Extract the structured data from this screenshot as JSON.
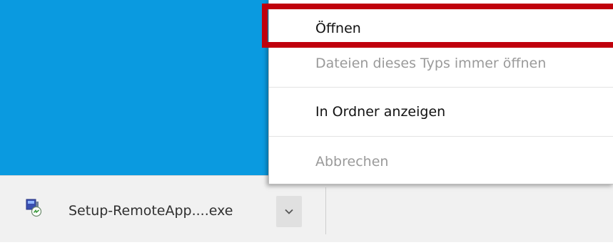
{
  "download_bar": {
    "file_name": "Setup-RemoteApp....exe",
    "file_icon": "installer-icon",
    "menu_button_icon": "chevron-down-icon"
  },
  "context_menu": {
    "items": [
      {
        "label": "Öffnen",
        "enabled": true
      },
      {
        "label": "Dateien dieses Typs immer öffnen",
        "enabled": false
      },
      {
        "label": "In Ordner anzeigen",
        "enabled": true
      },
      {
        "label": "Abbrechen",
        "enabled": false
      }
    ]
  },
  "colors": {
    "desktop": "#0a9ae0",
    "highlight": "#c0000c",
    "disabled_text": "#9a9a9a"
  }
}
